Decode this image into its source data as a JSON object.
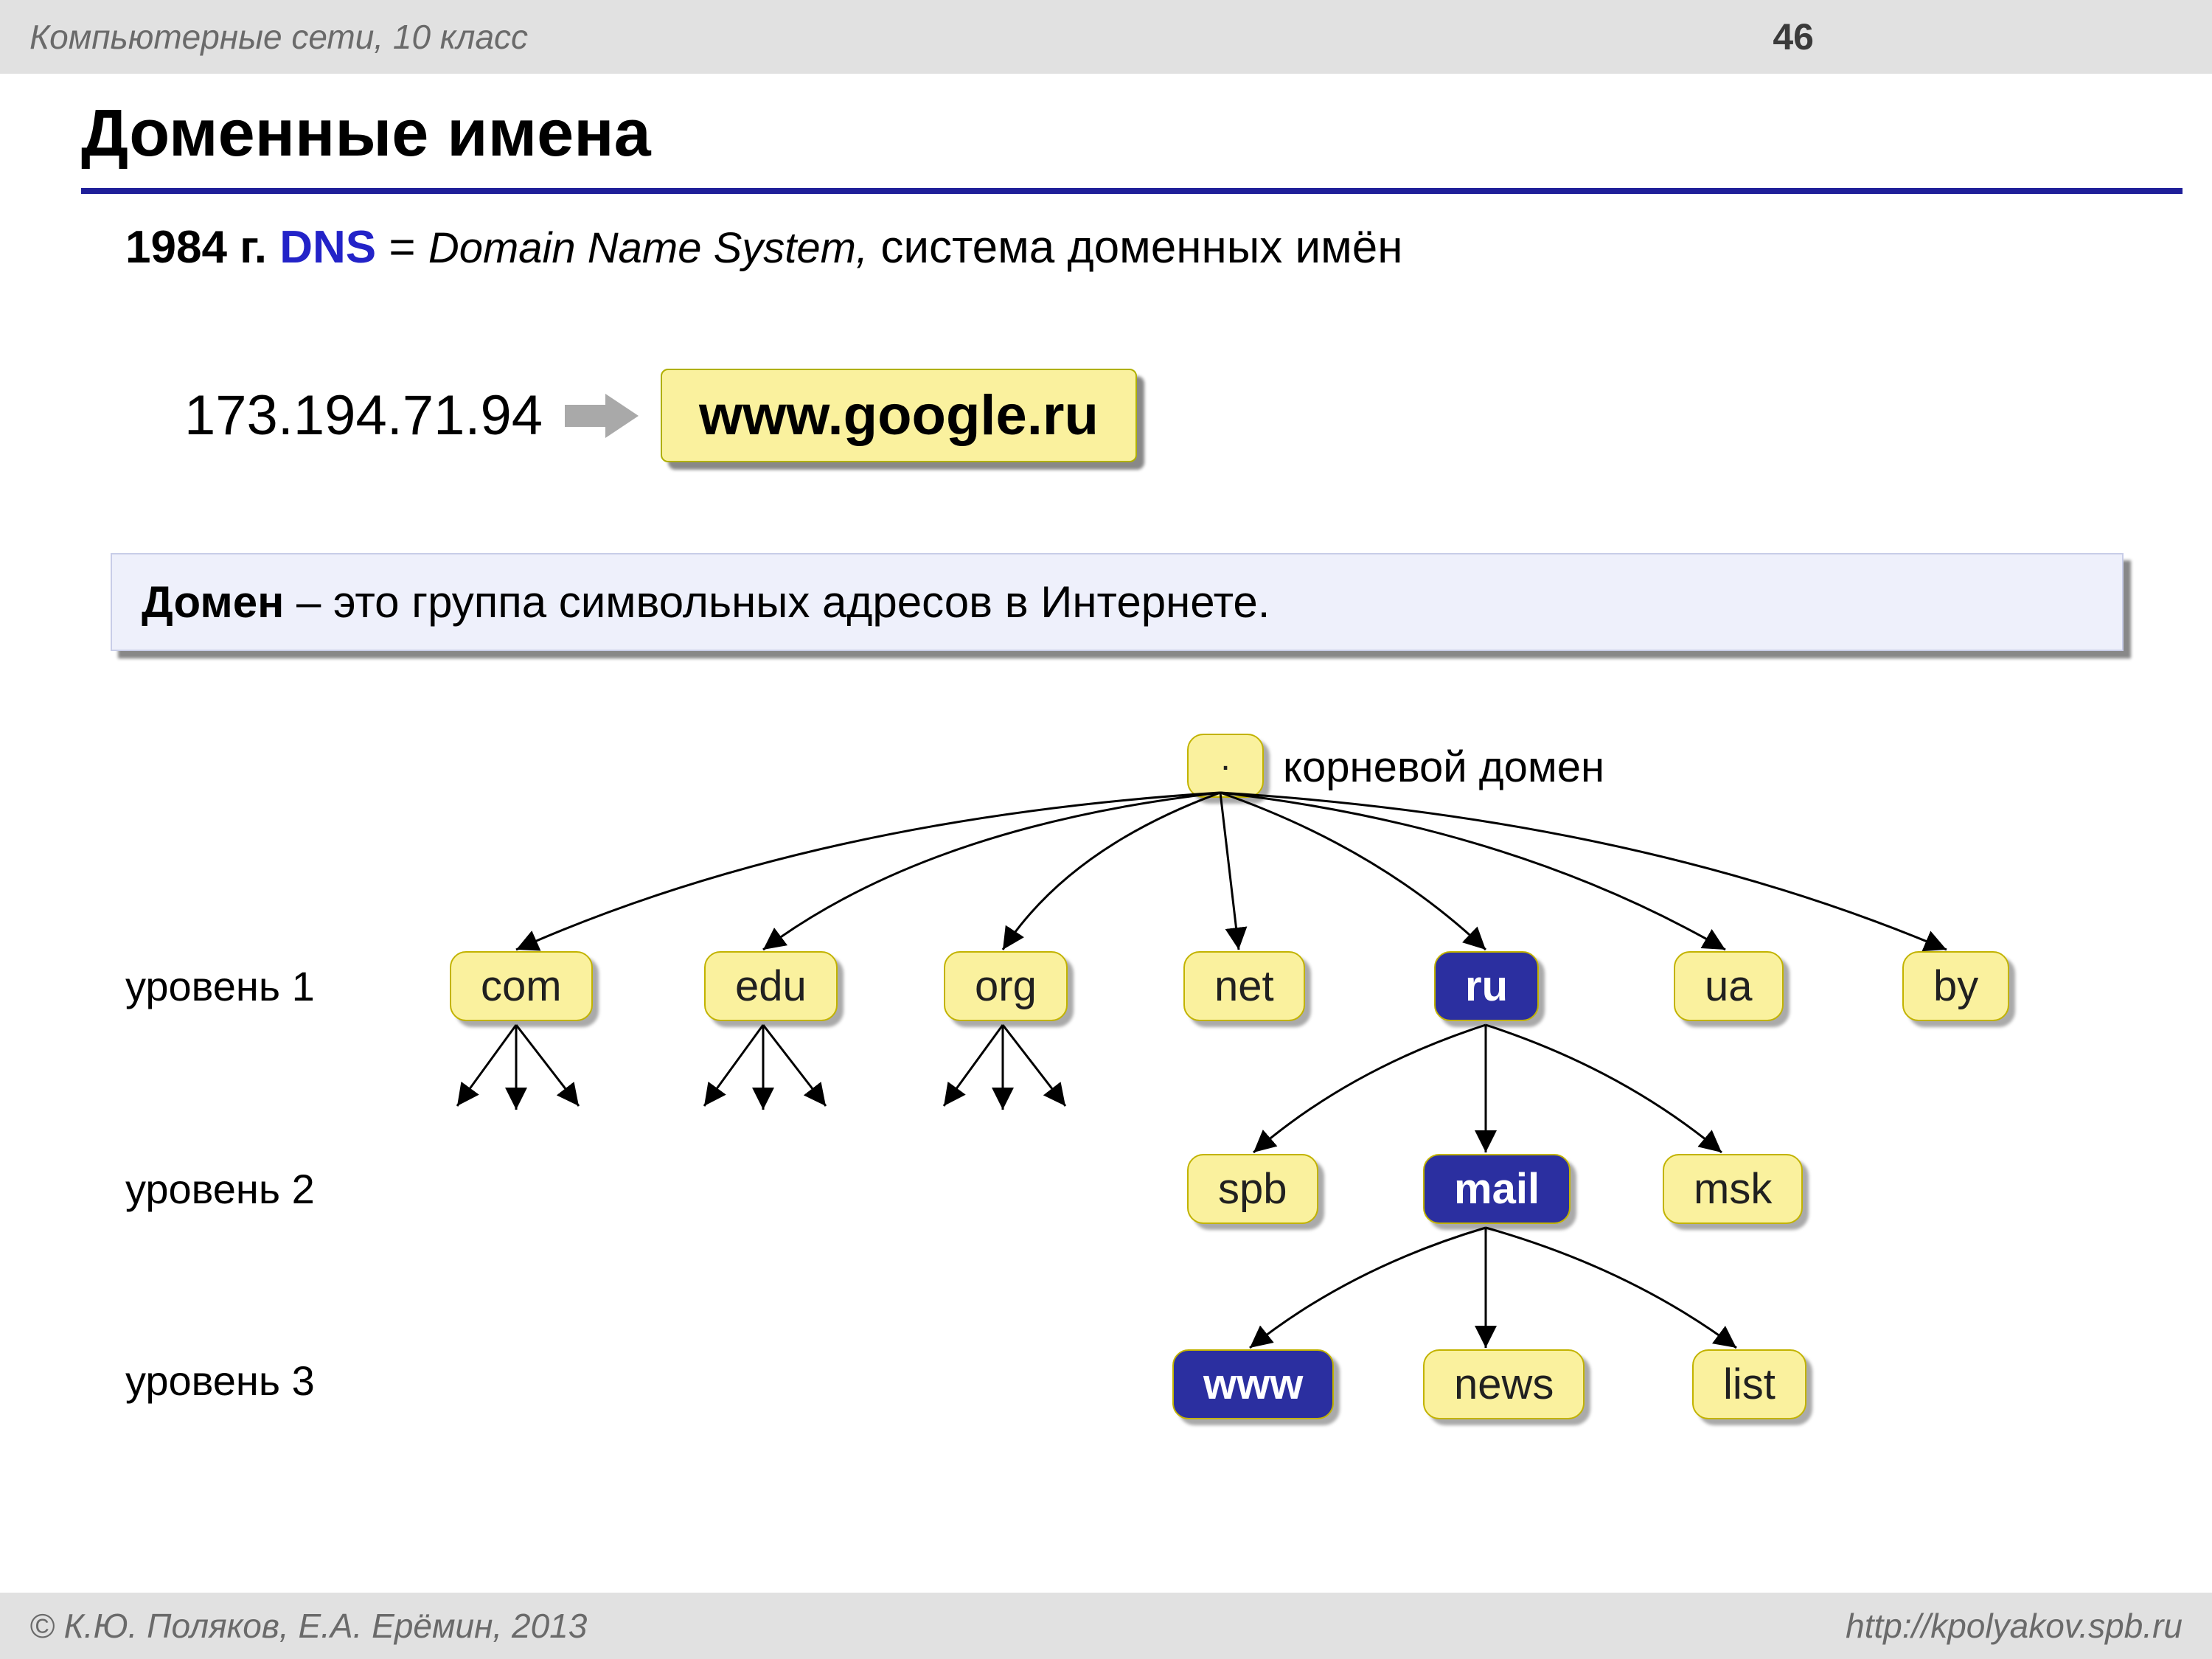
{
  "header": {
    "subject": "Компьютерные сети, 10 класс",
    "page_number": "46"
  },
  "title": "Доменные имена",
  "intro": {
    "year": "1984 г.",
    "dns": "DNS",
    "eq": " = ",
    "expand": "Domain Name System,",
    "tail": " система доменных имён"
  },
  "example": {
    "ip": "173.194.71.94",
    "domain": "www.google.ru"
  },
  "definition": {
    "term": "Домен",
    "text": " – это группа символьных адресов в Интернете."
  },
  "tree": {
    "root_label": "корневой домен",
    "root": ".",
    "levels": {
      "l1": "уровень 1",
      "l2": "уровень 2",
      "l3": "уровень 3"
    },
    "level1": [
      "com",
      "edu",
      "org",
      "net",
      "ru",
      "ua",
      "by"
    ],
    "level2": [
      "spb",
      "mail",
      "msk"
    ],
    "level3": [
      "www",
      "news",
      "list"
    ]
  },
  "footer": {
    "copyright": "© К.Ю. Поляков, Е.А. Ерёмин, 2013",
    "url": "http://kpolyakov.spb.ru"
  }
}
